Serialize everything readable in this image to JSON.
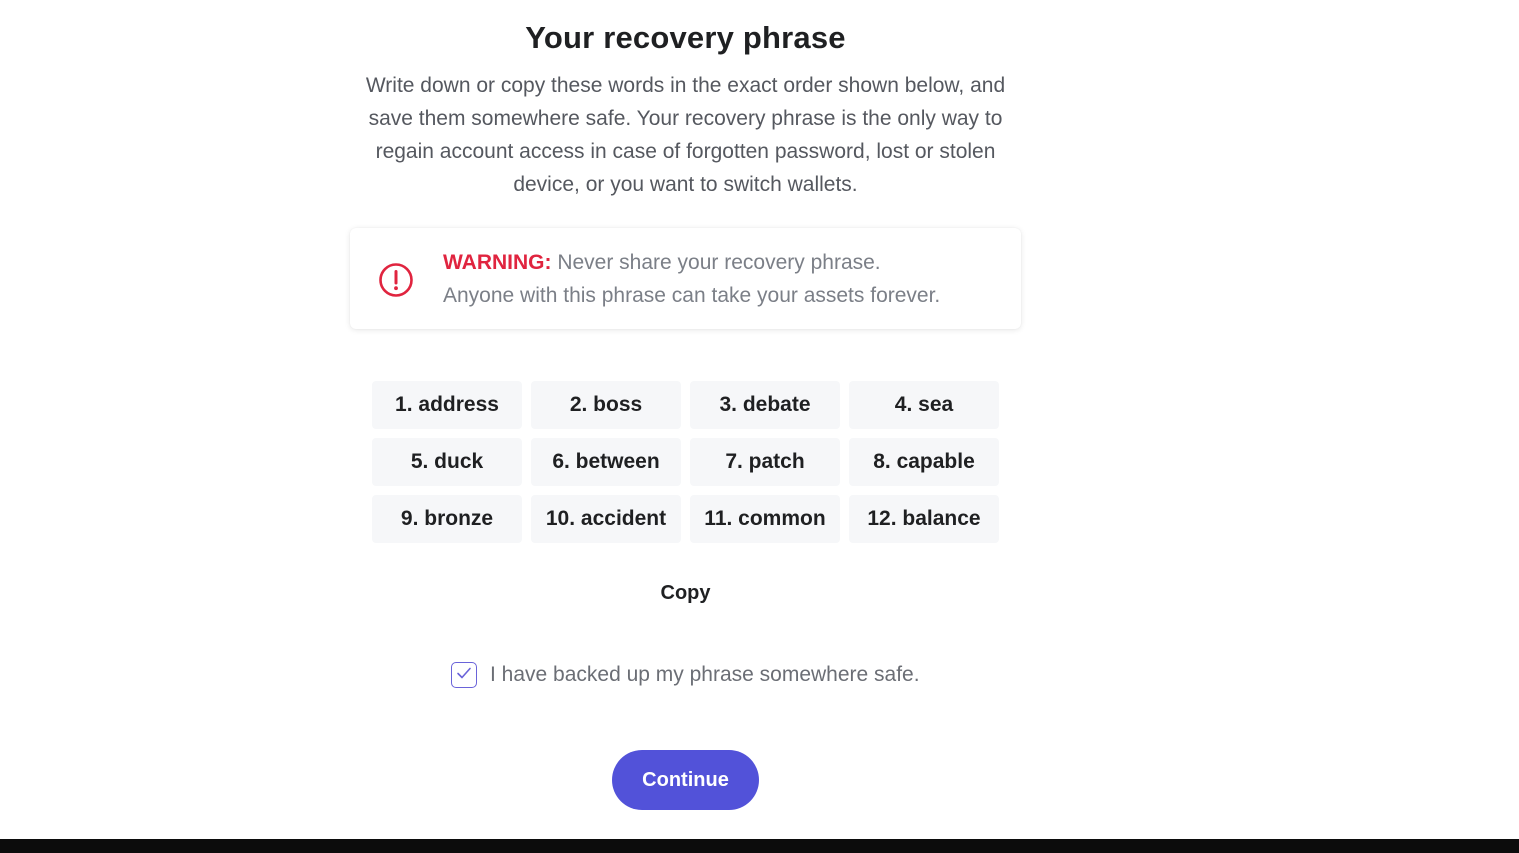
{
  "page": {
    "title": "Your recovery phrase",
    "description": "Write down or copy these words in the exact order shown below, and save them somewhere safe. Your recovery phrase is the only way to regain account access in case of forgotten password, lost or stolen device, or you want to switch wallets."
  },
  "warning": {
    "label": "WARNING:",
    "line1": " Never share your recovery phrase.",
    "line2": "Anyone with this phrase can take your assets forever.",
    "icon": "exclamation-circle-icon",
    "color": "#e0243f"
  },
  "phrase": {
    "words": [
      "1. address",
      "2. boss",
      "3. debate",
      "4. sea",
      "5. duck",
      "6. between",
      "7. patch",
      "8. capable",
      "9. bronze",
      "10. accident",
      "11. common",
      "12. balance"
    ]
  },
  "actions": {
    "copy_label": "Copy",
    "continue_label": "Continue",
    "accent_color": "#5252d9"
  },
  "backup": {
    "checked": true,
    "label": "I have backed up my phrase somewhere safe.",
    "icon": "checkmark-icon"
  }
}
